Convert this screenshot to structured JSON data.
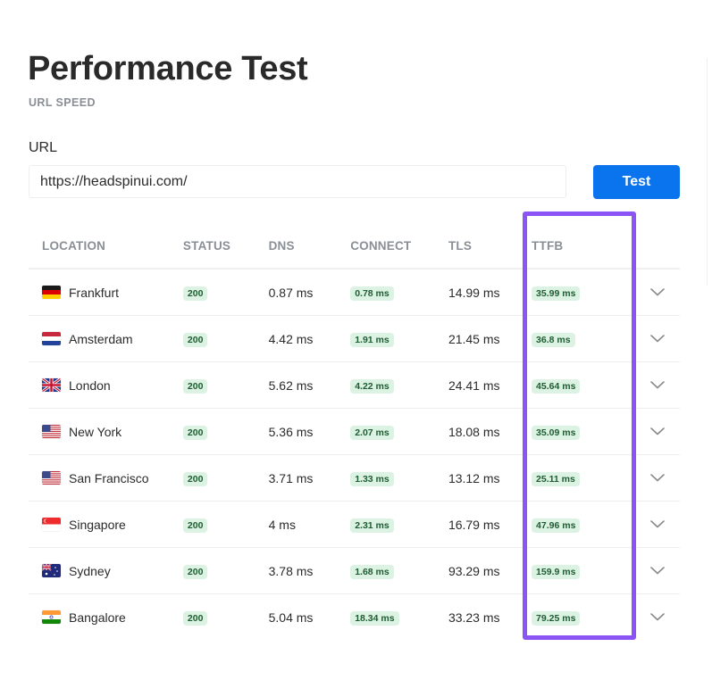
{
  "header": {
    "title": "Performance Test",
    "subtitle": "URL SPEED"
  },
  "form": {
    "url_label": "URL",
    "url_value": "https://headspinui.com/",
    "test_button_label": "Test"
  },
  "table": {
    "columns": [
      "LOCATION",
      "STATUS",
      "DNS",
      "CONNECT",
      "TLS",
      "TTFB"
    ],
    "highlighted_column": "TTFB",
    "rows": [
      {
        "flag": "germany-flag",
        "location": "Frankfurt",
        "status": "200",
        "dns": "0.87 ms",
        "connect": "0.78 ms",
        "tls": "14.99 ms",
        "ttfb": "35.99 ms"
      },
      {
        "flag": "netherlands-flag",
        "location": "Amsterdam",
        "status": "200",
        "dns": "4.42 ms",
        "connect": "1.91 ms",
        "tls": "21.45 ms",
        "ttfb": "36.8 ms"
      },
      {
        "flag": "uk-flag",
        "location": "London",
        "status": "200",
        "dns": "5.62 ms",
        "connect": "4.22 ms",
        "tls": "24.41 ms",
        "ttfb": "45.64 ms"
      },
      {
        "flag": "usa-flag",
        "location": "New York",
        "status": "200",
        "dns": "5.36 ms",
        "connect": "2.07 ms",
        "tls": "18.08 ms",
        "ttfb": "35.09 ms"
      },
      {
        "flag": "usa-flag",
        "location": "San Francisco",
        "status": "200",
        "dns": "3.71 ms",
        "connect": "1.33 ms",
        "tls": "13.12 ms",
        "ttfb": "25.11 ms"
      },
      {
        "flag": "singapore-flag",
        "location": "Singapore",
        "status": "200",
        "dns": "4 ms",
        "connect": "2.31 ms",
        "tls": "16.79 ms",
        "ttfb": "47.96 ms"
      },
      {
        "flag": "australia-flag",
        "location": "Sydney",
        "status": "200",
        "dns": "3.78 ms",
        "connect": "1.68 ms",
        "tls": "93.29 ms",
        "ttfb": "159.9 ms"
      },
      {
        "flag": "india-flag",
        "location": "Bangalore",
        "status": "200",
        "dns": "5.04 ms",
        "connect": "18.34 ms",
        "tls": "33.23 ms",
        "ttfb": "79.25 ms"
      }
    ]
  },
  "colors": {
    "accent_button": "#0a74ee",
    "highlight_border": "#8b55f5",
    "badge_bg": "#dcf2e2",
    "badge_text": "#1f5c33"
  }
}
